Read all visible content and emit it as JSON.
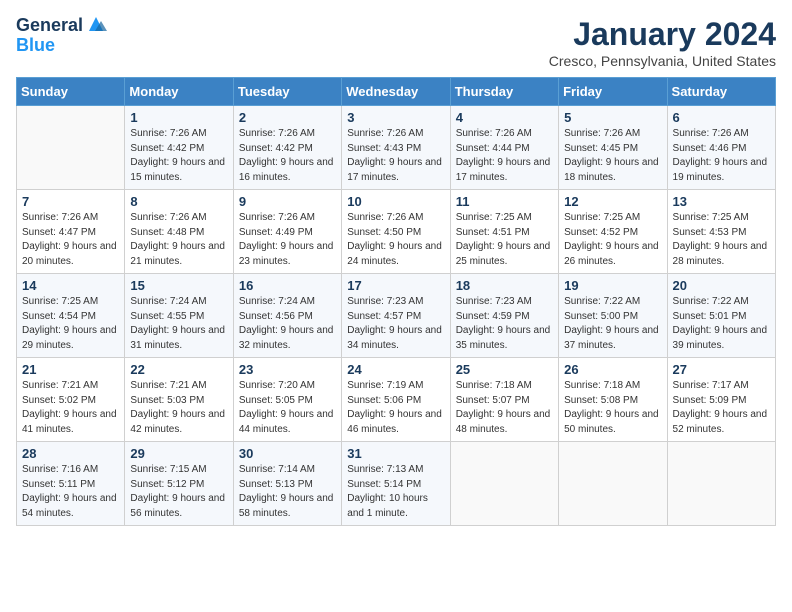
{
  "header": {
    "logo_line1": "General",
    "logo_line2": "Blue",
    "month": "January 2024",
    "location": "Cresco, Pennsylvania, United States"
  },
  "weekdays": [
    "Sunday",
    "Monday",
    "Tuesday",
    "Wednesday",
    "Thursday",
    "Friday",
    "Saturday"
  ],
  "weeks": [
    [
      {
        "day": "",
        "sunrise": "",
        "sunset": "",
        "daylight": ""
      },
      {
        "day": "1",
        "sunrise": "Sunrise: 7:26 AM",
        "sunset": "Sunset: 4:42 PM",
        "daylight": "Daylight: 9 hours and 15 minutes."
      },
      {
        "day": "2",
        "sunrise": "Sunrise: 7:26 AM",
        "sunset": "Sunset: 4:42 PM",
        "daylight": "Daylight: 9 hours and 16 minutes."
      },
      {
        "day": "3",
        "sunrise": "Sunrise: 7:26 AM",
        "sunset": "Sunset: 4:43 PM",
        "daylight": "Daylight: 9 hours and 17 minutes."
      },
      {
        "day": "4",
        "sunrise": "Sunrise: 7:26 AM",
        "sunset": "Sunset: 4:44 PM",
        "daylight": "Daylight: 9 hours and 17 minutes."
      },
      {
        "day": "5",
        "sunrise": "Sunrise: 7:26 AM",
        "sunset": "Sunset: 4:45 PM",
        "daylight": "Daylight: 9 hours and 18 minutes."
      },
      {
        "day": "6",
        "sunrise": "Sunrise: 7:26 AM",
        "sunset": "Sunset: 4:46 PM",
        "daylight": "Daylight: 9 hours and 19 minutes."
      }
    ],
    [
      {
        "day": "7",
        "sunrise": "Sunrise: 7:26 AM",
        "sunset": "Sunset: 4:47 PM",
        "daylight": "Daylight: 9 hours and 20 minutes."
      },
      {
        "day": "8",
        "sunrise": "Sunrise: 7:26 AM",
        "sunset": "Sunset: 4:48 PM",
        "daylight": "Daylight: 9 hours and 21 minutes."
      },
      {
        "day": "9",
        "sunrise": "Sunrise: 7:26 AM",
        "sunset": "Sunset: 4:49 PM",
        "daylight": "Daylight: 9 hours and 23 minutes."
      },
      {
        "day": "10",
        "sunrise": "Sunrise: 7:26 AM",
        "sunset": "Sunset: 4:50 PM",
        "daylight": "Daylight: 9 hours and 24 minutes."
      },
      {
        "day": "11",
        "sunrise": "Sunrise: 7:25 AM",
        "sunset": "Sunset: 4:51 PM",
        "daylight": "Daylight: 9 hours and 25 minutes."
      },
      {
        "day": "12",
        "sunrise": "Sunrise: 7:25 AM",
        "sunset": "Sunset: 4:52 PM",
        "daylight": "Daylight: 9 hours and 26 minutes."
      },
      {
        "day": "13",
        "sunrise": "Sunrise: 7:25 AM",
        "sunset": "Sunset: 4:53 PM",
        "daylight": "Daylight: 9 hours and 28 minutes."
      }
    ],
    [
      {
        "day": "14",
        "sunrise": "Sunrise: 7:25 AM",
        "sunset": "Sunset: 4:54 PM",
        "daylight": "Daylight: 9 hours and 29 minutes."
      },
      {
        "day": "15",
        "sunrise": "Sunrise: 7:24 AM",
        "sunset": "Sunset: 4:55 PM",
        "daylight": "Daylight: 9 hours and 31 minutes."
      },
      {
        "day": "16",
        "sunrise": "Sunrise: 7:24 AM",
        "sunset": "Sunset: 4:56 PM",
        "daylight": "Daylight: 9 hours and 32 minutes."
      },
      {
        "day": "17",
        "sunrise": "Sunrise: 7:23 AM",
        "sunset": "Sunset: 4:57 PM",
        "daylight": "Daylight: 9 hours and 34 minutes."
      },
      {
        "day": "18",
        "sunrise": "Sunrise: 7:23 AM",
        "sunset": "Sunset: 4:59 PM",
        "daylight": "Daylight: 9 hours and 35 minutes."
      },
      {
        "day": "19",
        "sunrise": "Sunrise: 7:22 AM",
        "sunset": "Sunset: 5:00 PM",
        "daylight": "Daylight: 9 hours and 37 minutes."
      },
      {
        "day": "20",
        "sunrise": "Sunrise: 7:22 AM",
        "sunset": "Sunset: 5:01 PM",
        "daylight": "Daylight: 9 hours and 39 minutes."
      }
    ],
    [
      {
        "day": "21",
        "sunrise": "Sunrise: 7:21 AM",
        "sunset": "Sunset: 5:02 PM",
        "daylight": "Daylight: 9 hours and 41 minutes."
      },
      {
        "day": "22",
        "sunrise": "Sunrise: 7:21 AM",
        "sunset": "Sunset: 5:03 PM",
        "daylight": "Daylight: 9 hours and 42 minutes."
      },
      {
        "day": "23",
        "sunrise": "Sunrise: 7:20 AM",
        "sunset": "Sunset: 5:05 PM",
        "daylight": "Daylight: 9 hours and 44 minutes."
      },
      {
        "day": "24",
        "sunrise": "Sunrise: 7:19 AM",
        "sunset": "Sunset: 5:06 PM",
        "daylight": "Daylight: 9 hours and 46 minutes."
      },
      {
        "day": "25",
        "sunrise": "Sunrise: 7:18 AM",
        "sunset": "Sunset: 5:07 PM",
        "daylight": "Daylight: 9 hours and 48 minutes."
      },
      {
        "day": "26",
        "sunrise": "Sunrise: 7:18 AM",
        "sunset": "Sunset: 5:08 PM",
        "daylight": "Daylight: 9 hours and 50 minutes."
      },
      {
        "day": "27",
        "sunrise": "Sunrise: 7:17 AM",
        "sunset": "Sunset: 5:09 PM",
        "daylight": "Daylight: 9 hours and 52 minutes."
      }
    ],
    [
      {
        "day": "28",
        "sunrise": "Sunrise: 7:16 AM",
        "sunset": "Sunset: 5:11 PM",
        "daylight": "Daylight: 9 hours and 54 minutes."
      },
      {
        "day": "29",
        "sunrise": "Sunrise: 7:15 AM",
        "sunset": "Sunset: 5:12 PM",
        "daylight": "Daylight: 9 hours and 56 minutes."
      },
      {
        "day": "30",
        "sunrise": "Sunrise: 7:14 AM",
        "sunset": "Sunset: 5:13 PM",
        "daylight": "Daylight: 9 hours and 58 minutes."
      },
      {
        "day": "31",
        "sunrise": "Sunrise: 7:13 AM",
        "sunset": "Sunset: 5:14 PM",
        "daylight": "Daylight: 10 hours and 1 minute."
      },
      {
        "day": "",
        "sunrise": "",
        "sunset": "",
        "daylight": ""
      },
      {
        "day": "",
        "sunrise": "",
        "sunset": "",
        "daylight": ""
      },
      {
        "day": "",
        "sunrise": "",
        "sunset": "",
        "daylight": ""
      }
    ]
  ]
}
